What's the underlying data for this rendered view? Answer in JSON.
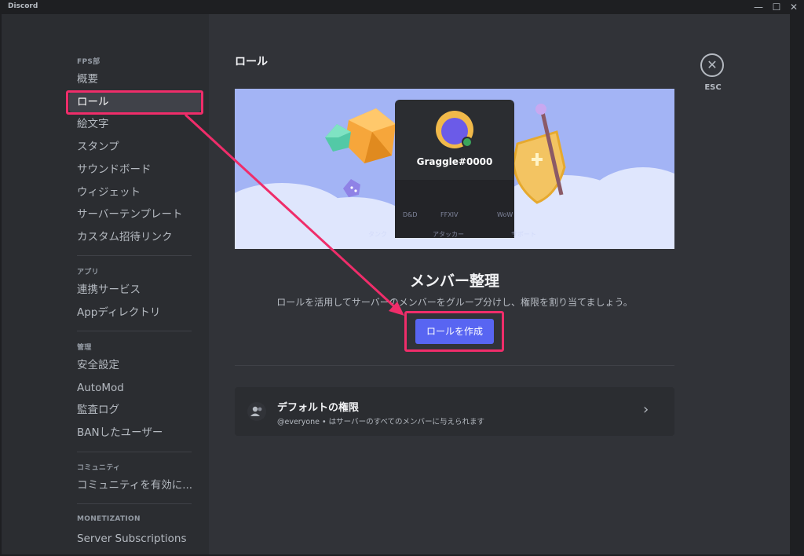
{
  "window": {
    "title": "Discord",
    "minimize": "—",
    "maximize": "☐",
    "close": "✕"
  },
  "sidebar": {
    "server_section": "FPS部",
    "server_items": [
      "概要",
      "ロール",
      "絵文字",
      "スタンプ",
      "サウンドボード",
      "ウィジェット",
      "サーバーテンプレート",
      "カスタム招待リンク"
    ],
    "apps_section": "アプリ",
    "apps_items": [
      "連携サービス",
      "Appディレクトリ"
    ],
    "mod_section": "管理",
    "mod_items": [
      "安全設定",
      "AutoMod",
      "監査ログ",
      "BANしたユーザー"
    ],
    "community_section": "コミュニティ",
    "community_items": [
      "コミュニティを有効に..."
    ],
    "monetization_section": "MONETIZATION",
    "monetization_items": [
      "Server Subscriptions"
    ]
  },
  "main": {
    "title": "ロール",
    "close_label": "ESC",
    "hero": {
      "username": "Graggle#0000",
      "role_tags": [
        "D&D",
        "FFXIV",
        "WoW"
      ],
      "role_tags_row2": [
        "タンク",
        "アタッカー",
        "サポート"
      ]
    },
    "headline": "メンバー整理",
    "description": "ロールを活用してサーバーのメンバーをグループ分けし、権限を割り当てましょう。",
    "create_button": "ロールを作成",
    "default_perms": {
      "title": "デフォルトの権限",
      "subtitle": "@everyone • はサーバーのすべてのメンバーに与えられます"
    }
  },
  "colors": {
    "accent": "#5865f2",
    "highlight": "#ef2d6a",
    "sidebar_bg": "#2b2d31",
    "main_bg": "#313338"
  }
}
